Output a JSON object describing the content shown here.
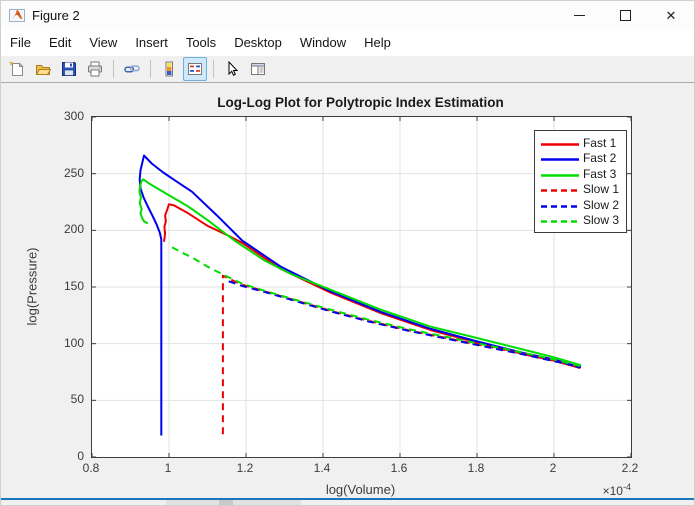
{
  "window": {
    "title": "Figure 2",
    "controls": {
      "minimize": "minimize",
      "maximize": "maximize",
      "close": "close"
    }
  },
  "menu": {
    "items": [
      "File",
      "Edit",
      "View",
      "Insert",
      "Tools",
      "Desktop",
      "Window",
      "Help"
    ]
  },
  "toolbar": {
    "buttons": [
      {
        "name": "new-figure-button",
        "icon": "new-document-icon"
      },
      {
        "name": "open-file-button",
        "icon": "open-folder-icon"
      },
      {
        "name": "save-figure-button",
        "icon": "save-icon"
      },
      {
        "name": "print-figure-button",
        "icon": "print-icon"
      },
      {
        "type": "separator"
      },
      {
        "name": "link-plot-button",
        "icon": "link-icon"
      },
      {
        "type": "separator"
      },
      {
        "name": "insert-colorbar-button",
        "icon": "colorbar-icon"
      },
      {
        "name": "insert-legend-button",
        "icon": "legend-icon",
        "selected": true
      },
      {
        "type": "separator"
      },
      {
        "name": "edit-plot-button",
        "icon": "cursor-arrow-icon"
      },
      {
        "name": "property-inspector-button",
        "icon": "property-inspector-icon"
      }
    ]
  },
  "chart_data": {
    "type": "line",
    "title": "Log-Log Plot for Polytropic Index Estimation",
    "xlabel": "log(Volume)",
    "ylabel": "log(Pressure)",
    "multiplier": {
      "base": "×10",
      "exponent": "-4"
    },
    "xlim": [
      0.8,
      2.2
    ],
    "ylim": [
      0,
      300
    ],
    "xticks": [
      0.8,
      1,
      1.2,
      1.4,
      1.6,
      1.8,
      2,
      2.2
    ],
    "xtick_labels": [
      "0.8",
      "1",
      "1.2",
      "1.4",
      "1.6",
      "1.8",
      "2",
      "2.2"
    ],
    "yticks": [
      0,
      50,
      100,
      150,
      200,
      250,
      300
    ],
    "ytick_labels": [
      "0",
      "50",
      "100",
      "150",
      "200",
      "250",
      "300"
    ],
    "grid": true,
    "legend_position": "northeast",
    "x_units_note": "x values in units of 1e-4",
    "series": [
      {
        "name": "Fast 1",
        "color": "#ee0000",
        "style": "solid",
        "points": [
          [
            0.987,
            190
          ],
          [
            0.99,
            197
          ],
          [
            0.988,
            203
          ],
          [
            0.992,
            208
          ],
          [
            0.99,
            213
          ],
          [
            0.995,
            218
          ],
          [
            1.0,
            223
          ],
          [
            1.013,
            222
          ],
          [
            1.05,
            215
          ],
          [
            1.1,
            204
          ],
          [
            1.15,
            196
          ],
          [
            1.19,
            189
          ],
          [
            1.29,
            166
          ],
          [
            1.42,
            145
          ],
          [
            1.55,
            127
          ],
          [
            1.68,
            112
          ],
          [
            1.8,
            101
          ],
          [
            1.93,
            90
          ],
          [
            2.0,
            85
          ],
          [
            2.068,
            78.5
          ]
        ]
      },
      {
        "name": "Fast 2",
        "color": "#0000ee",
        "style": "solid",
        "points": [
          [
            0.98,
            19
          ],
          [
            0.98,
            192
          ],
          [
            0.976,
            198
          ],
          [
            0.968,
            205
          ],
          [
            0.957,
            213
          ],
          [
            0.945,
            221
          ],
          [
            0.934,
            229
          ],
          [
            0.926,
            237
          ],
          [
            0.924,
            245
          ],
          [
            0.926,
            253
          ],
          [
            0.931,
            260
          ],
          [
            0.935,
            266
          ],
          [
            0.955,
            259
          ],
          [
            0.985,
            251
          ],
          [
            1.02,
            243
          ],
          [
            1.06,
            234
          ],
          [
            1.125,
            213
          ],
          [
            1.19,
            191
          ],
          [
            1.29,
            168
          ],
          [
            1.42,
            146
          ],
          [
            1.55,
            128
          ],
          [
            1.68,
            113
          ],
          [
            1.8,
            102
          ],
          [
            1.93,
            91
          ],
          [
            2.0,
            86
          ],
          [
            2.068,
            79
          ]
        ]
      },
      {
        "name": "Fast 3",
        "color": "#00dd00",
        "style": "solid",
        "points": [
          [
            0.945,
            206
          ],
          [
            0.935,
            208
          ],
          [
            0.93,
            211
          ],
          [
            0.926,
            215
          ],
          [
            0.929,
            219
          ],
          [
            0.924,
            224
          ],
          [
            0.927,
            229
          ],
          [
            0.923,
            234
          ],
          [
            0.925,
            239
          ],
          [
            0.928,
            243
          ],
          [
            0.933,
            245
          ],
          [
            0.95,
            241
          ],
          [
            0.98,
            235
          ],
          [
            1.0,
            231
          ],
          [
            1.05,
            221
          ],
          [
            1.1,
            209
          ],
          [
            1.17,
            191
          ],
          [
            1.25,
            173
          ],
          [
            1.32,
            161
          ],
          [
            1.42,
            147.5
          ],
          [
            1.55,
            130
          ],
          [
            1.68,
            115
          ],
          [
            1.8,
            105
          ],
          [
            1.93,
            94
          ],
          [
            2.0,
            88
          ],
          [
            2.07,
            81
          ]
        ]
      },
      {
        "name": "Slow 1",
        "color": "#ee0000",
        "style": "dashed",
        "points": [
          [
            1.14,
            20
          ],
          [
            1.14,
            160
          ],
          [
            1.17,
            155
          ],
          [
            1.19,
            152
          ],
          [
            1.25,
            146
          ],
          [
            1.32,
            139
          ],
          [
            1.42,
            129
          ],
          [
            1.52,
            120
          ],
          [
            1.62,
            112
          ],
          [
            1.72,
            105
          ],
          [
            1.82,
            98
          ],
          [
            1.92,
            91
          ],
          [
            2.0,
            85
          ],
          [
            2.07,
            79
          ]
        ]
      },
      {
        "name": "Slow 2",
        "color": "#0000ee",
        "style": "dashed",
        "points": [
          [
            1.155,
            155
          ],
          [
            1.19,
            151
          ],
          [
            1.25,
            145.5
          ],
          [
            1.32,
            138.5
          ],
          [
            1.42,
            128.5
          ],
          [
            1.52,
            119.5
          ],
          [
            1.62,
            111.5
          ],
          [
            1.72,
            104.5
          ],
          [
            1.82,
            97.5
          ],
          [
            1.92,
            90.5
          ],
          [
            2.0,
            84.5
          ],
          [
            2.07,
            79.5
          ]
        ]
      },
      {
        "name": "Slow 3",
        "color": "#00dd00",
        "style": "dashed",
        "points": [
          [
            1.008,
            185
          ],
          [
            1.03,
            181
          ],
          [
            1.06,
            176
          ],
          [
            1.1,
            168
          ],
          [
            1.14,
            161
          ],
          [
            1.19,
            153
          ],
          [
            1.25,
            146.5
          ],
          [
            1.32,
            139.5
          ],
          [
            1.42,
            130
          ],
          [
            1.52,
            121
          ],
          [
            1.62,
            113
          ],
          [
            1.72,
            106
          ],
          [
            1.82,
            99
          ],
          [
            1.92,
            92
          ],
          [
            2.0,
            86
          ],
          [
            2.07,
            80
          ]
        ]
      }
    ]
  }
}
